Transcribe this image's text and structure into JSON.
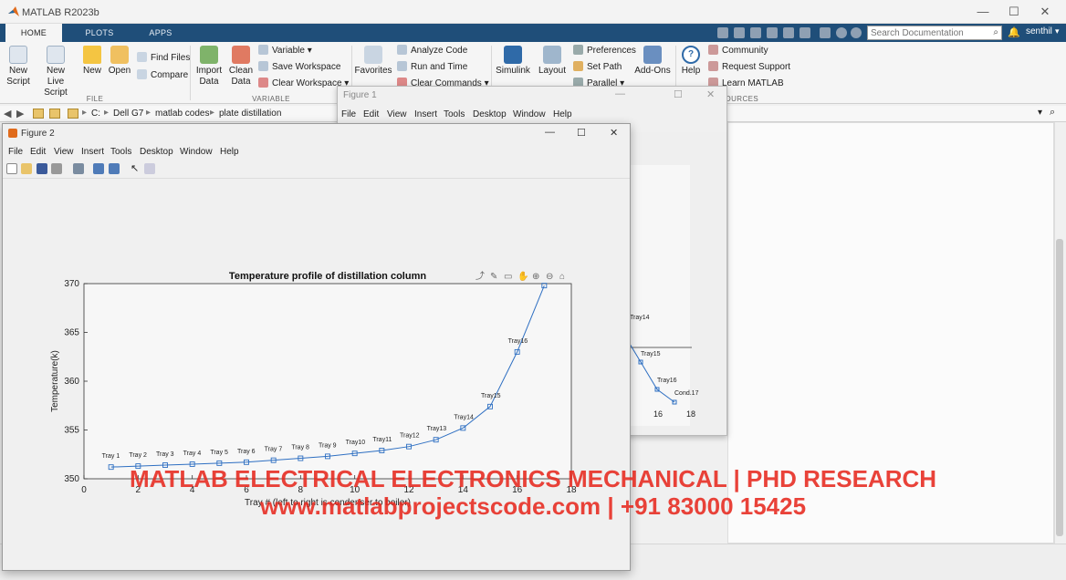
{
  "app": {
    "title": "MATLAB R2023b"
  },
  "tabs": [
    "HOME",
    "PLOTS",
    "APPS"
  ],
  "search": {
    "placeholder": "Search Documentation"
  },
  "user": "senthil",
  "ribbon": {
    "file": {
      "label": "FILE",
      "new_script": "New\nScript",
      "new_live_script": "New\nLive Script",
      "new": "New",
      "open": "Open",
      "find_files": "Find Files",
      "compare": "Compare"
    },
    "variable": {
      "label": "VARIABLE",
      "import_data": "Import\nData",
      "clean_data": "Clean\nData",
      "variable": "Variable ▾",
      "save_workspace": "Save Workspace",
      "clear_workspace": "Clear Workspace ▾"
    },
    "code": {
      "favorites": "Favorites",
      "analyze_code": "Analyze Code",
      "run_and_time": "Run and Time",
      "clear_commands": "Clear Commands ▾"
    },
    "env": {
      "simulink": "Simulink",
      "layout": "Layout",
      "preferences": "Preferences",
      "set_path": "Set Path",
      "parallel": "Parallel ▾",
      "add_ons": "Add-Ons"
    },
    "resources": {
      "label": "RESOURCES",
      "help": "Help",
      "community": "Community",
      "request_support": "Request Support",
      "learn_matlab": "Learn MATLAB"
    }
  },
  "address": {
    "parts": [
      "C:",
      "Dell G7",
      "matlab codes",
      "plate distillation"
    ]
  },
  "figure1": {
    "title": "Figure 1",
    "menu": [
      "File",
      "Edit",
      "View",
      "Insert",
      "Tools",
      "Desktop",
      "Window",
      "Help"
    ],
    "visible_labels": [
      "Tray14",
      "Tray15",
      "Tray16",
      "Cond.17"
    ],
    "visible_ticks": [
      "16",
      "18"
    ]
  },
  "figure2": {
    "title": "Figure 2",
    "menu": [
      "File",
      "Edit",
      "View",
      "Insert",
      "Tools",
      "Desktop",
      "Window",
      "Help"
    ]
  },
  "chart_data": {
    "type": "line",
    "title": "Temperature profile of distillation column",
    "xlabel": "Tray # (left to right is condenser to boiler)",
    "ylabel": "Temperature(k)",
    "xlim": [
      0,
      18
    ],
    "ylim": [
      350,
      370
    ],
    "xticks": [
      0,
      2,
      4,
      6,
      8,
      10,
      12,
      14,
      16,
      18
    ],
    "yticks": [
      350,
      355,
      360,
      365,
      370
    ],
    "grid": false,
    "marker": "square",
    "color": "#2e6fc2",
    "x": [
      1,
      2,
      3,
      4,
      5,
      6,
      7,
      8,
      9,
      10,
      11,
      12,
      13,
      14,
      15,
      16,
      17
    ],
    "y": [
      351.2,
      351.3,
      351.4,
      351.5,
      351.6,
      351.7,
      351.9,
      352.1,
      352.3,
      352.6,
      352.9,
      353.3,
      354.0,
      355.2,
      357.4,
      363.0,
      369.8
    ],
    "point_labels": [
      "Tray 1",
      "Tray 2",
      "Tray 3",
      "Tray 4",
      "Tray 5",
      "Tray 6",
      "Tray 7",
      "Tray 8",
      "Tray 9",
      "Tray10",
      "Tray11",
      "Tray12",
      "Tray13",
      "Tray14",
      "Tray15",
      "Tray16",
      ""
    ]
  },
  "watermark": {
    "line1": "MATLAB ELECTRICAL ELECTRONICS MECHANICAL | PHD RESEARCH",
    "line2": "www.matlabprojectscode.com | +91 83000 15425"
  }
}
